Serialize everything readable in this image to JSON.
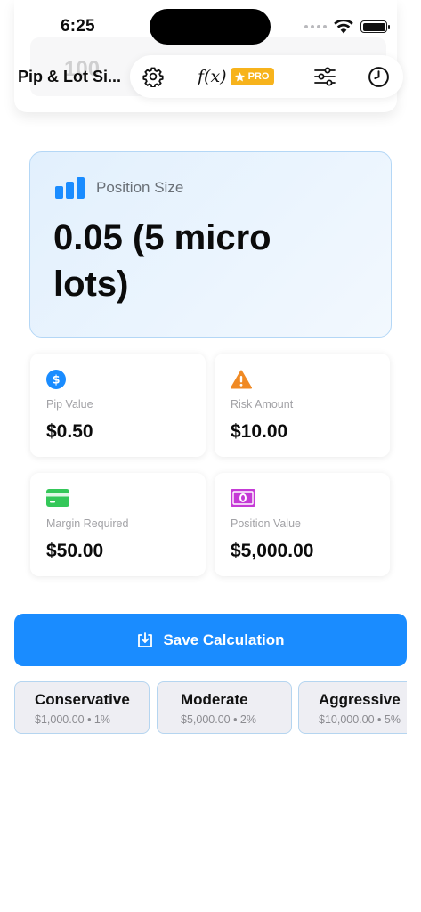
{
  "status_bar": {
    "time": "6:25"
  },
  "background": {
    "field_value": "100"
  },
  "nav": {
    "title": "Pip & Lot Si..."
  },
  "toolbar": {
    "fx_label": "f(x)",
    "pro_label": "PRO"
  },
  "result": {
    "label": "Position Size",
    "value": "0.05 (5 micro lots)"
  },
  "metrics": [
    {
      "label": "Pip Value",
      "value": "$0.50",
      "icon": "dollar-circle-icon",
      "color": "#1a8cff"
    },
    {
      "label": "Risk Amount",
      "value": "$10.00",
      "icon": "warning-triangle-icon",
      "color": "#f08a24"
    },
    {
      "label": "Margin Required",
      "value": "$50.00",
      "icon": "credit-card-icon",
      "color": "#34c759"
    },
    {
      "label": "Position Value",
      "value": "$5,000.00",
      "icon": "banknote-icon",
      "color": "#c53ad6"
    }
  ],
  "save_button": {
    "label": "Save Calculation"
  },
  "presets": [
    {
      "name": "Conservative",
      "detail": "$1,000.00 • 1%"
    },
    {
      "name": "Moderate",
      "detail": "$5,000.00 • 2%"
    },
    {
      "name": "Aggressive",
      "detail": "$10,000.00 • 5%"
    }
  ],
  "colors": {
    "accent": "#1a8cff",
    "pro": "#f7b31c",
    "hero_border": "#b4d7f6"
  }
}
